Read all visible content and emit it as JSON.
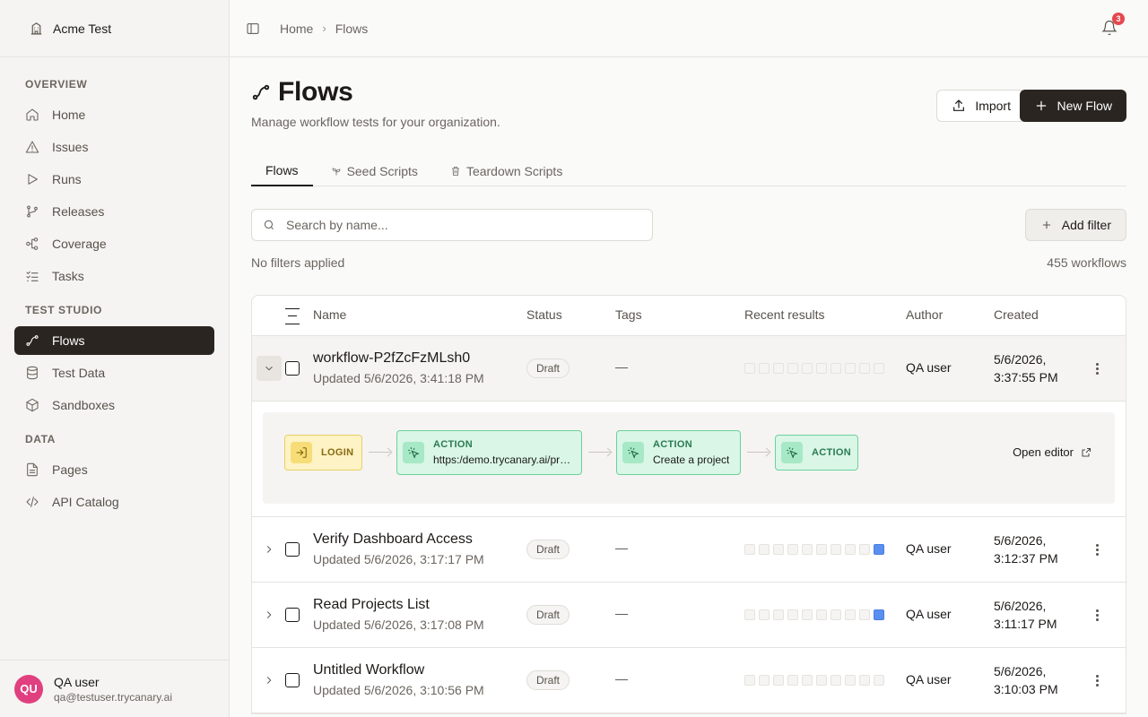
{
  "org": {
    "name": "Acme Test"
  },
  "sidebar": {
    "sections": [
      {
        "title": "OVERVIEW",
        "items": [
          {
            "label": "Home",
            "icon": "home-icon"
          },
          {
            "label": "Issues",
            "icon": "alert-triangle-icon"
          },
          {
            "label": "Runs",
            "icon": "play-icon"
          },
          {
            "label": "Releases",
            "icon": "git-branch-icon"
          },
          {
            "label": "Coverage",
            "icon": "network-icon"
          },
          {
            "label": "Tasks",
            "icon": "list-checks-icon"
          }
        ]
      },
      {
        "title": "TEST STUDIO",
        "items": [
          {
            "label": "Flows",
            "icon": "flow-icon",
            "active": true
          },
          {
            "label": "Test Data",
            "icon": "database-icon"
          },
          {
            "label": "Sandboxes",
            "icon": "box-icon"
          }
        ]
      },
      {
        "title": "DATA",
        "items": [
          {
            "label": "Pages",
            "icon": "file-icon"
          },
          {
            "label": "API Catalog",
            "icon": "code-icon"
          }
        ]
      }
    ]
  },
  "user": {
    "initials": "QU",
    "name": "QA user",
    "email": "qa@testuser.trycanary.ai"
  },
  "breadcrumb": {
    "home": "Home",
    "current": "Flows"
  },
  "notifications": {
    "count": "3"
  },
  "page": {
    "title": "Flows",
    "subtitle": "Manage workflow tests for your organization.",
    "import_label": "Import",
    "new_label": "New Flow"
  },
  "tabs": [
    {
      "label": "Flows",
      "active": true
    },
    {
      "label": "Seed Scripts"
    },
    {
      "label": "Teardown Scripts"
    }
  ],
  "search": {
    "placeholder": "Search by name..."
  },
  "filter": {
    "add_label": "Add filter",
    "status": "No filters applied",
    "count": "455 workflows"
  },
  "table": {
    "columns": {
      "name": "Name",
      "status": "Status",
      "tags": "Tags",
      "results": "Recent results",
      "author": "Author",
      "created": "Created"
    },
    "rows": [
      {
        "name": "workflow-P2fZcFzMLsh0",
        "updated": "Updated 5/6/2026, 3:41:18 PM",
        "status": "Draft",
        "tags": "—",
        "results": [
          0,
          0,
          0,
          0,
          0,
          0,
          0,
          0,
          0,
          0
        ],
        "author": "QA user",
        "created_date": "5/6/2026,",
        "created_time": "3:37:55 PM",
        "expanded": true
      },
      {
        "name": "Verify Dashboard Access",
        "updated": "Updated 5/6/2026, 3:17:17 PM",
        "status": "Draft",
        "tags": "—",
        "results": [
          0,
          0,
          0,
          0,
          0,
          0,
          0,
          0,
          0,
          1
        ],
        "author": "QA user",
        "created_date": "5/6/2026,",
        "created_time": "3:12:37 PM"
      },
      {
        "name": "Read Projects List",
        "updated": "Updated 5/6/2026, 3:17:08 PM",
        "status": "Draft",
        "tags": "—",
        "results": [
          0,
          0,
          0,
          0,
          0,
          0,
          0,
          0,
          0,
          1
        ],
        "author": "QA user",
        "created_date": "5/6/2026,",
        "created_time": "3:11:17 PM"
      },
      {
        "name": "Untitled Workflow",
        "updated": "Updated 5/6/2026, 3:10:56 PM",
        "status": "Draft",
        "tags": "—",
        "results": [
          0,
          0,
          0,
          0,
          0,
          0,
          0,
          0,
          0,
          0
        ],
        "author": "QA user",
        "created_date": "5/6/2026,",
        "created_time": "3:10:03 PM"
      }
    ]
  },
  "expanded_flow": {
    "steps": [
      {
        "kind": "LOGIN"
      },
      {
        "kind": "ACTION",
        "desc": "https:/demo.trycanary.ai/pr…"
      },
      {
        "kind": "ACTION",
        "desc": "Create a project"
      },
      {
        "kind": "ACTION"
      }
    ],
    "open_editor": "Open editor"
  },
  "colors": {
    "accent": "#2b2522",
    "login": "#fdf3c4",
    "action": "#d9f6e6",
    "result_pass": "#5a8ff0",
    "avatar": "#e0407f",
    "badge": "#e5484d"
  }
}
